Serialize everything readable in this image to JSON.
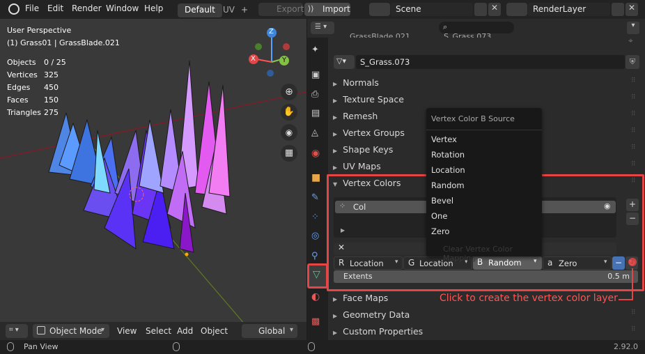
{
  "topbar": {
    "menus": [
      "File",
      "Edit",
      "Render",
      "Window",
      "Help"
    ],
    "workspace_tabs": [
      "Default",
      "UV"
    ],
    "add_tab": "+",
    "export": "Export",
    "import": "Import",
    "scene": "Scene",
    "render_layer": "RenderLayer"
  },
  "viewport": {
    "title": "User Perspective",
    "subtitle": "(1) Grass01 | GrassBlade.021",
    "stats": [
      {
        "label": "Objects",
        "value": "0 / 25"
      },
      {
        "label": "Vertices",
        "value": "325"
      },
      {
        "label": "Edges",
        "value": "450"
      },
      {
        "label": "Faces",
        "value": "150"
      },
      {
        "label": "Triangles",
        "value": "275"
      }
    ],
    "gizmo": {
      "z": "Z",
      "y": "Y",
      "x": "X"
    },
    "header": {
      "mode": "Object Mode",
      "menus": [
        "View",
        "Select",
        "Add",
        "Object"
      ],
      "transform": "Global"
    }
  },
  "props": {
    "breadcrumb_object": "GrassBlade.021",
    "breadcrumb_mesh": "S_Grass.073",
    "mesh_name": "S_Grass.073",
    "panels": [
      "Normals",
      "Texture Space",
      "Remesh",
      "Vertex Groups",
      "Shape Keys",
      "UV Maps",
      "Vertex Colors"
    ],
    "vc_layer": "Col",
    "sources": [
      {
        "channel": "R",
        "value": "Location"
      },
      {
        "channel": "G",
        "value": "Location"
      },
      {
        "channel": "B",
        "value": "Random"
      },
      {
        "channel": "a",
        "value": "Zero"
      }
    ],
    "extents_label": "Extents",
    "extents_value": "0.5 m",
    "lower_panels": [
      "Face Maps",
      "Geometry Data",
      "Custom Properties"
    ]
  },
  "popup": {
    "title": "Vertex Color B Source",
    "items": [
      "Vertex",
      "Rotation",
      "Location",
      "Random",
      "Bevel",
      "One",
      "Zero"
    ],
    "hidden_item": "Clear Vertex Color Mapping"
  },
  "callout": "Click to create the vertex color layer",
  "status": {
    "left": "Pan View",
    "version": "2.92.0"
  },
  "colors": {
    "accent": "#4772b3",
    "callout": "#e64545"
  }
}
